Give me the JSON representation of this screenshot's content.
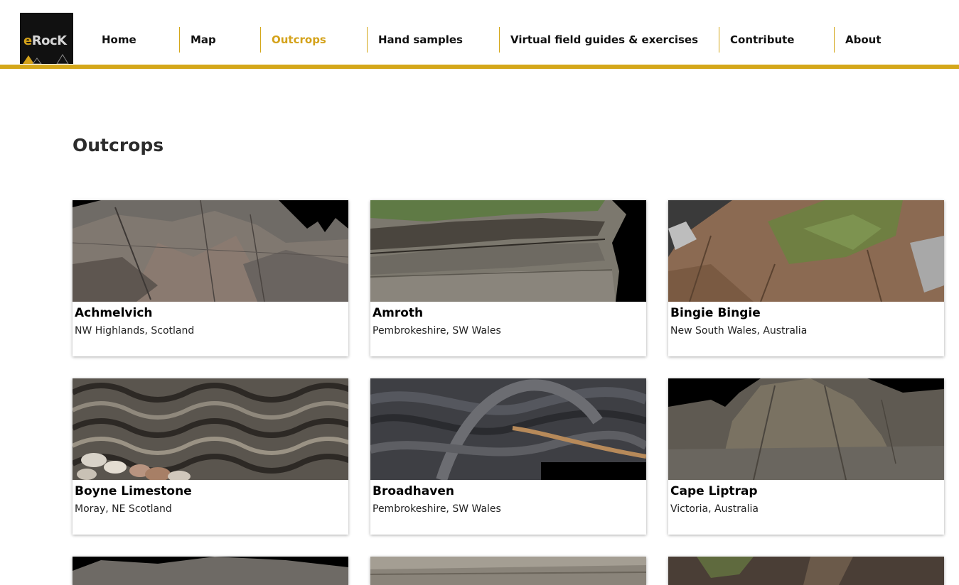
{
  "brand": {
    "logo_text_e": "e",
    "logo_text_rest": "RocK",
    "accent_color": "#d4a71a"
  },
  "nav": {
    "items": [
      {
        "label": "Home"
      },
      {
        "label": "Map"
      },
      {
        "label": "Outcrops",
        "active": true
      },
      {
        "label": "Hand samples"
      },
      {
        "label": "Virtual field guides & exercises"
      },
      {
        "label": "Contribute"
      },
      {
        "label": "About"
      }
    ]
  },
  "page": {
    "title": "Outcrops"
  },
  "outcrops": [
    {
      "name": "Achmelvich",
      "region": "NW Highlands, Scotland"
    },
    {
      "name": "Amroth",
      "region": "Pembrokeshire, SW Wales"
    },
    {
      "name": "Bingie Bingie",
      "region": "New South Wales, Australia"
    },
    {
      "name": "Boyne Limestone",
      "region": "Moray, NE Scotland"
    },
    {
      "name": "Broadhaven",
      "region": "Pembrokeshire, SW Wales"
    },
    {
      "name": "Cape Liptrap",
      "region": "Victoria, Australia"
    }
  ]
}
